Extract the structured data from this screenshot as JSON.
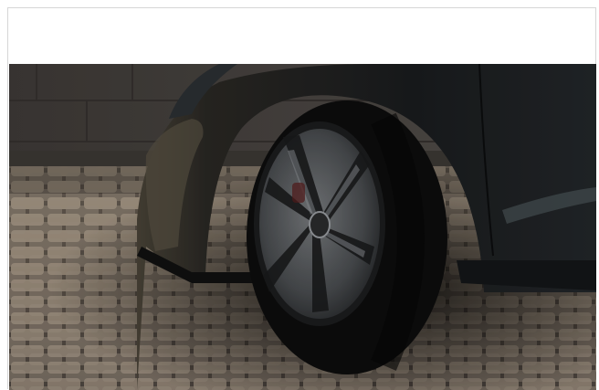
{
  "viewer": {
    "image_subject": "car-front-wheel-photo"
  },
  "colors": {
    "page_background": "#ffffff",
    "frame_border": "#d6d6d6",
    "wall": "#4a4542",
    "cobblestone_light": "#b7a896",
    "cobblestone_dark": "#3c3732",
    "car_body": "#1c1f21",
    "tire": "#101010",
    "rim": "#5c5f62"
  }
}
